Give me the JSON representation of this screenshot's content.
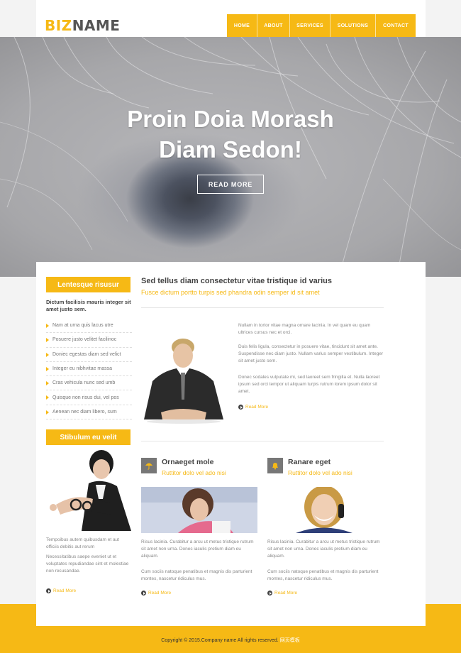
{
  "brand": {
    "part1": "BIZ",
    "part2": "NAME"
  },
  "nav": [
    "HOME",
    "ABOUT",
    "SERVICES",
    "SOLUTIONS",
    "CONTACT"
  ],
  "hero": {
    "title_line1": "Proin Doia Morash",
    "title_line2": "Diam Sedon!",
    "button": "READ MORE"
  },
  "sidebar": {
    "heading1": "Lentesque risusur",
    "intro": "Dictum facilisis mauris integer sit amet justo sem.",
    "items": [
      "Nam at urna quis lacus utre",
      "Posuere justo velitet facilinoc",
      "Doniec egestas diam sed velict",
      "Integer eu nibhvitae massa",
      "Cras vehicula nunc sed umb",
      "Quisque non risus dui, vel pos",
      "Aenean nec diam libero, sum"
    ],
    "heading2": "Stibulum eu velit",
    "text1": "Tempoibus autem quibusdam et aut officiis debitis aut rerum",
    "text2": "Necessitatibus saepe eveniet ut et voluptates repudiandae sint et molestiae non recusandae.",
    "read_more": "Read More"
  },
  "main": {
    "title": "Sed tellus diam consectetur vitae tristique id varius",
    "subtitle": "Fusce dictum portto turpis sed phandra odin semper id sit amet",
    "p1": "Nullam in tortor vitae magna ornare lacinia. In vel quam eu quam ultrices cursus nec et orci.",
    "p2": "Duis felis ligula, consectetur in posuere vitae, tincidunt sit amet ante. Suspendisse nec diam justo. Nullam varius semper vestibulum. Integer sit amet justo sem.",
    "p3": "Donec sodales vulputate mi, sed laoreet sem fringilla et. Nulla laoreet ipsum sed orci tempor ut aliquam turpis rutrum lorem ipsum dolor sit amet.",
    "read_more": "Read More"
  },
  "features": [
    {
      "title": "Ornaeget mole",
      "subtitle": "Ruttitor dolo vel ado nisi",
      "icon": "umbrella-icon",
      "p1": "Risus lacinia. Curabitur a arcu ut metus tristique rutrum sit amet non urna. Donec iaculis pretium diam eu aliquam.",
      "p2": "Cum sociis natoque penatibus et magnis dis parturient montes, nascetur ridiculus mus.",
      "read_more": "Read More"
    },
    {
      "title": "Ranare eget",
      "subtitle": "Ruttitor dolo vel ado nisi",
      "icon": "bell-icon",
      "p1": "Risus lacinia. Curabitur a arcu ut metus tristique rutrum sit amet non urna. Donec iaculis pretium diam eu aliquam.",
      "p2": "Cum sociis natoque penatibus et magnis dis parturient montes, nascetur ridiculus mus.",
      "read_more": "Read More"
    }
  ],
  "footer": {
    "copyright": "Copyright © 2015.Company name All rights reserved.",
    "link": "网页模板"
  },
  "colors": {
    "accent": "#f6b915",
    "text": "#555555",
    "panel": "#ffffff"
  }
}
